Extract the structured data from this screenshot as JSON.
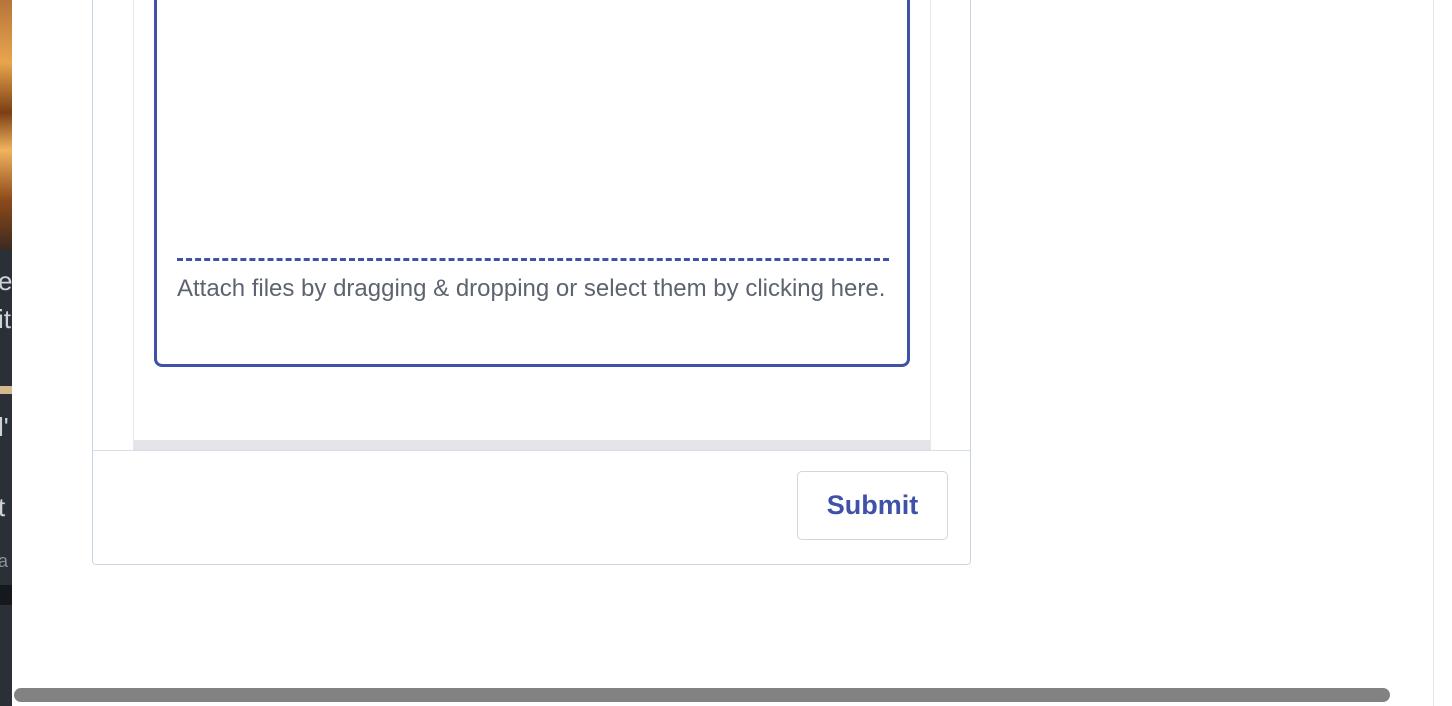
{
  "form": {
    "attach_hint": "Attach files by dragging & dropping or select them by clicking here.",
    "submit_label": "Submit"
  },
  "background_fragments": {
    "text_1": "e",
    "text_2": "it",
    "text_3": "l'",
    "text_4": "t",
    "text_5": "a"
  },
  "colors": {
    "accent": "#3f51a8",
    "hint_text": "#5d6470",
    "card_border": "#c8d6e3",
    "scrollbar_thumb": "#828282"
  }
}
